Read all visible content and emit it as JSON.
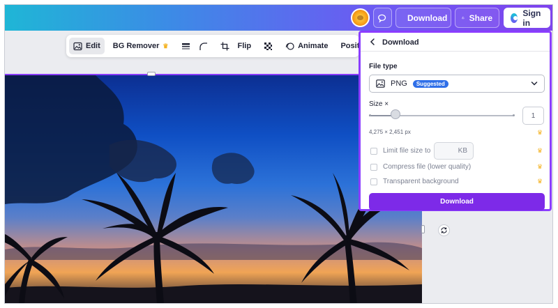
{
  "topbar": {
    "download_label": "Download",
    "share_label": "Share",
    "signin_label": "Sign in",
    "icons": [
      "user-avatar",
      "comment-icon",
      "download-icon",
      "share-icon",
      "canva-logo-icon"
    ]
  },
  "toolbar": {
    "edit_label": "Edit",
    "bg_remover_label": "BG Remover",
    "flip_label": "Flip",
    "animate_label": "Animate",
    "position_label": "Position"
  },
  "panel": {
    "title": "Download",
    "file_type_label": "File type",
    "file_type_value": "PNG",
    "suggested_badge": "Suggested",
    "size_label": "Size ×",
    "size_value": "1",
    "size_slider_fraction": 0.1,
    "dimensions_text": "4,275 × 2,451 px",
    "limit_label": "Limit file size to",
    "kb_unit": "KB",
    "compress_label": "Compress file (lower quality)",
    "transparent_label": "Transparent background",
    "download_button": "Download"
  },
  "colors": {
    "accent": "#8b3dff",
    "download_button": "#7d2ae8",
    "badge": "#2f6fe8",
    "premium_crown": "#f4b323"
  }
}
